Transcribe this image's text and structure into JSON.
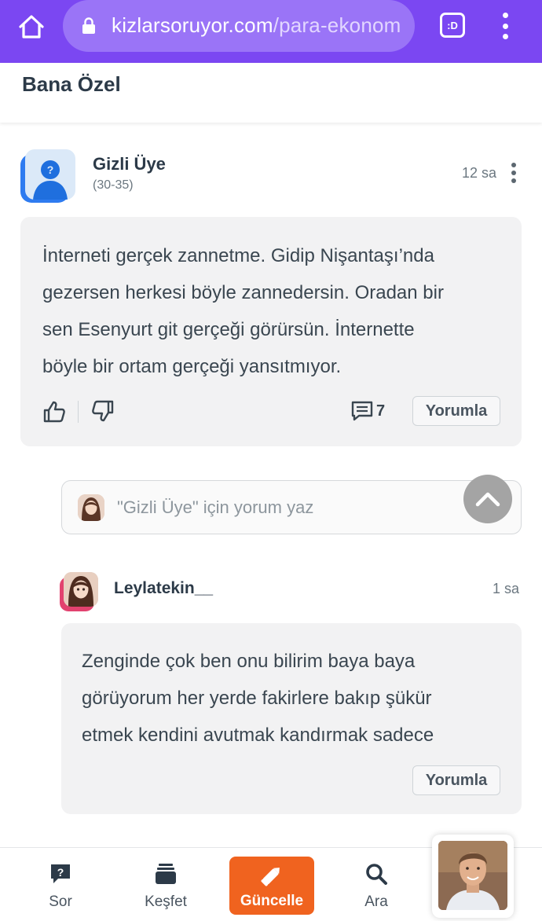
{
  "browser": {
    "url_host": "kizlarsoruyor.com",
    "url_path": "/para-ekonom",
    "tab_label": ":D"
  },
  "section": {
    "title": "Bana Özel"
  },
  "post": {
    "author": "Gizli Üye",
    "age": "(30-35)",
    "time": "12 sa",
    "lines": [
      "İnterneti gerçek zannetme. Gidip Nişantaşı’nda",
      "gezersen herkesi böyle zannedersin. Oradan bir",
      "sen Esenyurt git gerçeği görürsün. İnternette",
      "böyle bir ortam gerçeği yansıtmıyor."
    ],
    "comment_count": "7",
    "reply_label": "Yorumla"
  },
  "comment_input": {
    "placeholder": "\"Gizli Üye\" için yorum yaz"
  },
  "reply": {
    "author": "Leylatekin__",
    "time": "1 sa",
    "lines": [
      "Zenginde çok ben onu bilirim baya baya",
      "görüyorum her yerde fakirlere bakıp şükür",
      "etmek kendini avutmak kandırmak sadece"
    ],
    "reply_label": "Yorumla"
  },
  "bottom_nav": {
    "items": [
      {
        "label": "Sor",
        "icon": "question-icon"
      },
      {
        "label": "Keşfet",
        "icon": "cards-icon"
      },
      {
        "label": "Güncelle",
        "icon": "pencil-icon"
      },
      {
        "label": "Ara",
        "icon": "search-icon"
      }
    ],
    "active_color": "#f0631f"
  },
  "colors": {
    "browser_bar": "#7b47f2",
    "accent": "#f0631f",
    "avatar_border": "#2e7bf0",
    "reply_avatar_border": "#e2426f"
  }
}
